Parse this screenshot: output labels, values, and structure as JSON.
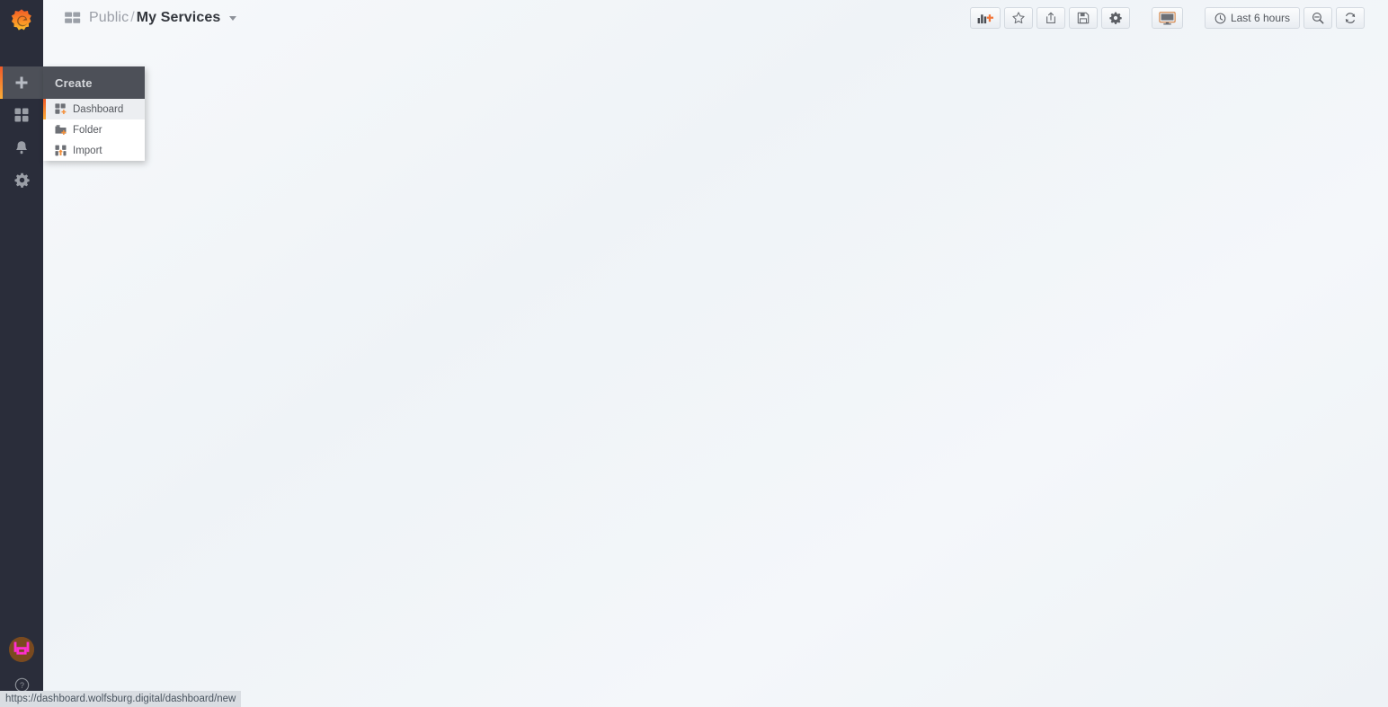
{
  "app": {
    "name": "Grafana",
    "accent_color": "#f05a28",
    "accent_color_alt": "#fbad37",
    "sidebar_bg": "#2a2d3a",
    "canvas_bg": "#f4f6f9"
  },
  "sidebar": {
    "logo": {
      "name": "grafana-logo",
      "title": "Grafana"
    },
    "items": [
      {
        "icon": "plus-icon",
        "label": "Create",
        "active": true
      },
      {
        "icon": "dashboards-icon",
        "label": "Dashboards",
        "active": false
      },
      {
        "icon": "bell-icon",
        "label": "Alerting",
        "active": false
      },
      {
        "icon": "gear-icon",
        "label": "Configuration",
        "active": false
      }
    ],
    "bottom": [
      {
        "icon": "avatar-icon",
        "label": "User profile"
      },
      {
        "icon": "help-icon",
        "label": "Help"
      }
    ]
  },
  "navbar": {
    "breadcrumb": {
      "icon": "dashboard-icon",
      "folder": "Public",
      "separator": "/",
      "dashboard": "My Services",
      "caret": "chevron-down-icon"
    },
    "toolbar": {
      "buttons": [
        {
          "icon": "add-panel-icon",
          "label": "Add panel"
        },
        {
          "icon": "star-icon",
          "label": "Mark as favorite"
        },
        {
          "icon": "share-icon",
          "label": "Share dashboard"
        },
        {
          "icon": "save-icon",
          "label": "Save dashboard"
        },
        {
          "icon": "gear-icon",
          "label": "Dashboard settings"
        }
      ],
      "kiosk": {
        "icon": "tv-icon",
        "label": "Cycle view mode"
      },
      "time_picker": {
        "icon": "clock-icon",
        "range": "Last 6 hours"
      },
      "zoom_out": {
        "icon": "zoom-out-icon",
        "label": "Zoom out time range"
      },
      "refresh": {
        "icon": "refresh-icon",
        "label": "Refresh dashboard"
      }
    }
  },
  "create_menu": {
    "header": "Create",
    "items": [
      {
        "icon": "dashboard-new-icon",
        "label": "Dashboard",
        "active": true
      },
      {
        "icon": "folder-new-icon",
        "label": "Folder",
        "active": false
      },
      {
        "icon": "import-icon",
        "label": "Import",
        "active": false
      }
    ]
  },
  "status_bar": {
    "url": "https://dashboard.wolfsburg.digital/dashboard/new"
  }
}
